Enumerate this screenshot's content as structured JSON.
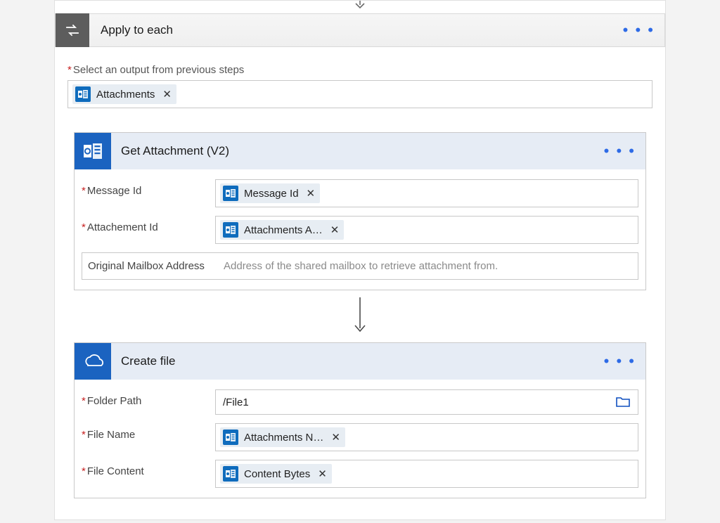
{
  "applyToEach": {
    "title": "Apply to each",
    "outputLabel": "Select an output from previous steps",
    "token": "Attachments"
  },
  "getAttachment": {
    "title": "Get Attachment (V2)",
    "params": {
      "messageId": {
        "label": "Message Id",
        "token": "Message Id"
      },
      "attachmentId": {
        "label": "Attachement Id",
        "token": "Attachments A…"
      },
      "mailbox": {
        "label": "Original Mailbox Address",
        "placeholder": "Address of the shared mailbox to retrieve attachment from."
      }
    }
  },
  "createFile": {
    "title": "Create file",
    "params": {
      "folderPath": {
        "label": "Folder Path",
        "value": "/File1"
      },
      "fileName": {
        "label": "File Name",
        "token": "Attachments N…"
      },
      "fileContent": {
        "label": "File Content",
        "token": "Content Bytes"
      }
    }
  }
}
